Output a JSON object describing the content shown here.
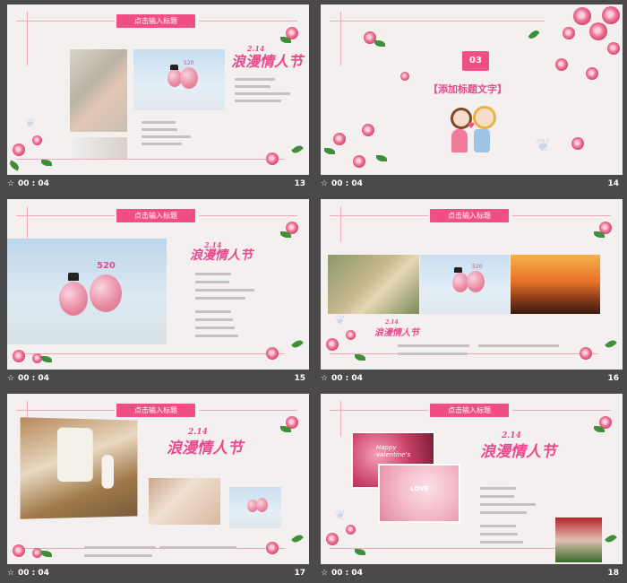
{
  "slides": [
    {
      "number": "13",
      "time": "00 : 04",
      "banner": "点击输入标题",
      "script": "浪漫情人节",
      "date": "2.14",
      "badge": "520"
    },
    {
      "number": "14",
      "time": "00 : 04",
      "section_number": "03",
      "heading": "【添加标题文字】"
    },
    {
      "number": "15",
      "time": "00 : 04",
      "banner": "点击输入标题",
      "script": "浪漫情人节",
      "date": "2.14",
      "badge": "520"
    },
    {
      "number": "16",
      "time": "00 : 04",
      "banner": "点击输入标题",
      "script": "浪漫情人节",
      "date": "2.14",
      "badge": "520"
    },
    {
      "number": "17",
      "time": "00 : 04",
      "banner": "点击输入标题",
      "script": "浪漫情人节",
      "date": "2.14"
    },
    {
      "number": "18",
      "time": "00 : 04",
      "banner": "点击输入标题",
      "script": "浪漫情人节",
      "date": "2.14",
      "card_text": "Happy valentine's",
      "card_text2": "LOVE"
    }
  ],
  "colors": {
    "accent": "#ef4f86",
    "background": "#4a4a4a",
    "slide_bg": "#f4f0ef"
  },
  "icons": {
    "status_star": "star-icon"
  }
}
